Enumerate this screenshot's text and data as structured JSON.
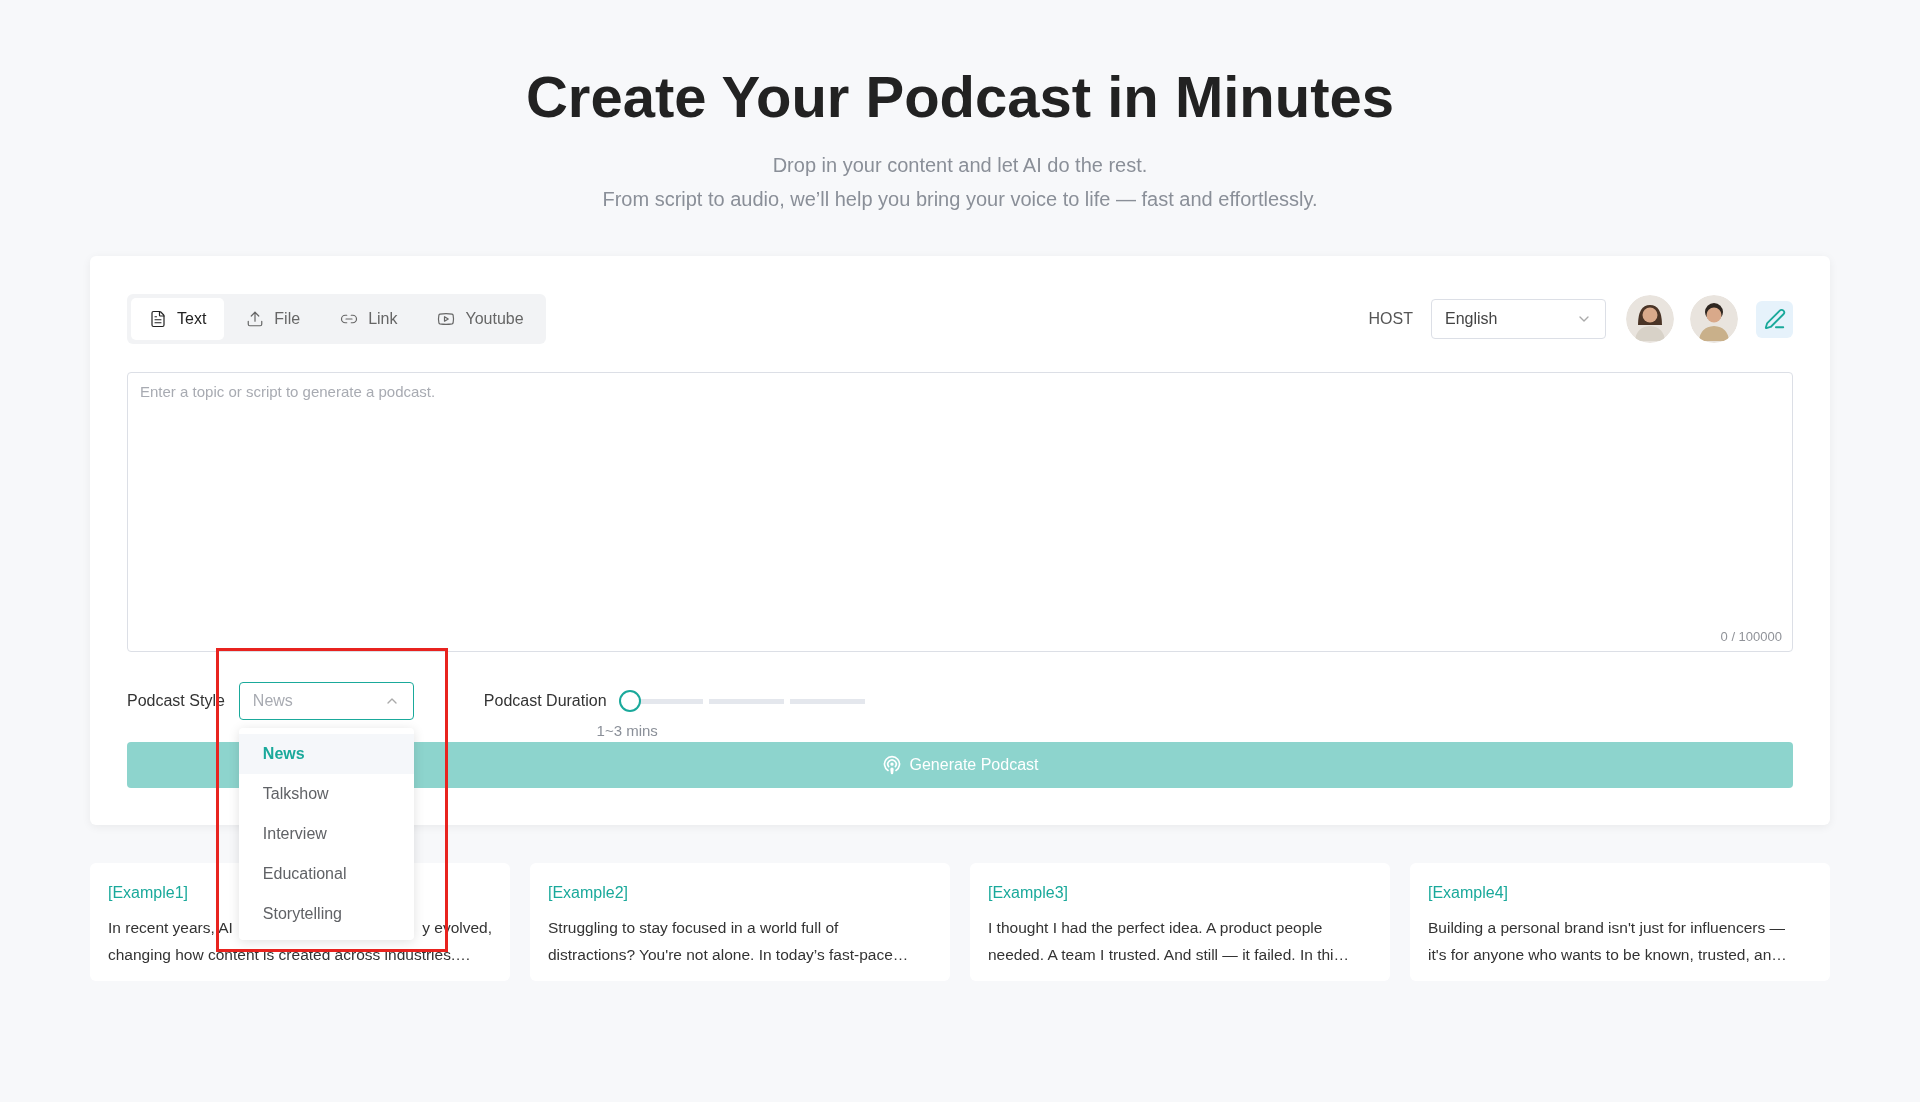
{
  "header": {
    "title": "Create Your Podcast in Minutes",
    "subtitle_lines": [
      "Drop in your content and let AI do the rest.",
      "From script to audio, we’ll help you bring your voice to life — fast and effortlessly."
    ]
  },
  "source_tabs": [
    {
      "label": "Text",
      "selected": true
    },
    {
      "label": "File",
      "selected": false
    },
    {
      "label": "Link",
      "selected": false
    },
    {
      "label": "Youtube",
      "selected": false
    }
  ],
  "host": {
    "label": "HOST",
    "language": "English",
    "avatars": [
      {
        "kind": "female"
      },
      {
        "kind": "male"
      }
    ]
  },
  "script_field": {
    "placeholder": "Enter a topic or script to generate a podcast.",
    "counter": "0 / 100000"
  },
  "podcast_style": {
    "label": "Podcast Style",
    "value": "News",
    "expanded": true,
    "options": [
      {
        "label": "News",
        "selected": true
      },
      {
        "label": "Talkshow",
        "selected": false
      },
      {
        "label": "Interview",
        "selected": false
      },
      {
        "label": "Educational",
        "selected": false
      },
      {
        "label": "Storytelling",
        "selected": false
      }
    ]
  },
  "podcast_duration": {
    "label": "Podcast Duration",
    "level": 0,
    "reading": "1~3 mins"
  },
  "generate_button": {
    "label": "Generate Podcast",
    "disabled": true
  },
  "examples": [
    {
      "title": "[Example1]",
      "lines": [
        [
          "In recent years, AI",
          "y evolved,"
        ],
        [
          "changing how content is created across industries.…"
        ]
      ]
    },
    {
      "title": "[Example2]",
      "lines": [
        [
          "Struggling to stay focused in a world full of"
        ],
        [
          "distractions? You're not alone. In today’s fast-pace…"
        ]
      ]
    },
    {
      "title": "[Example3]",
      "lines": [
        [
          "I thought I had the perfect idea. A product people"
        ],
        [
          "needed. A team I trusted. And still — it failed. In thi…"
        ]
      ]
    },
    {
      "title": "[Example4]",
      "lines": [
        [
          "Building a personal brand isn't just for influencers —"
        ],
        [
          "it's for anyone who wants to be known, trusted, an…"
        ]
      ]
    }
  ]
}
